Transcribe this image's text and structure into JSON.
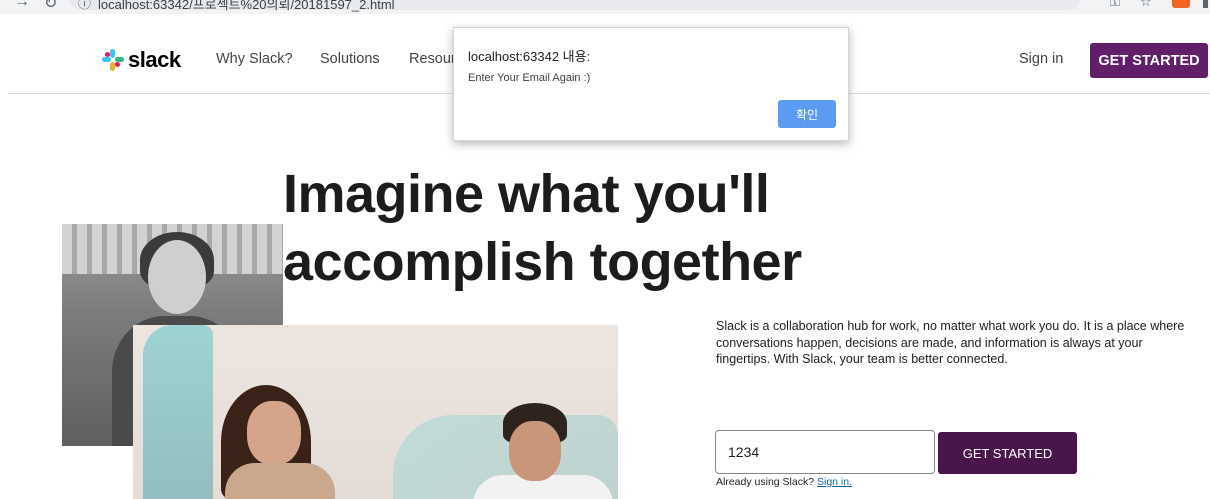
{
  "browser": {
    "url": "localhost:63342/프로젝트%20의뢰/20181597_2.html",
    "back_icon": "arrow-back-icon",
    "reload_icon": "reload-icon",
    "info_icon": "info-icon",
    "key_icon": "key-icon",
    "star_icon": "star-icon"
  },
  "header": {
    "logo_text": "slack",
    "nav": [
      "Why Slack?",
      "Solutions",
      "Resour"
    ],
    "sign_in": "Sign in",
    "get_started": "GET STARTED"
  },
  "hero": {
    "title_line1": "Imagine what you'll",
    "title_line2": "accomplish together",
    "description": "Slack is a collaboration hub for work, no matter what work you do. It is a place where conversations happen, decisions are made, and information is always at your fingertips. With Slack, your team is better connected."
  },
  "form": {
    "email_value": "1234",
    "get_started": "GET STARTED",
    "already_text": "Already using Slack?",
    "sign_in_link": "Sign in."
  },
  "dialog": {
    "title": "localhost:63342 내용:",
    "message": "Enter Your Email Again :)",
    "ok_label": "확인"
  },
  "colors": {
    "brand_purple": "#611f69",
    "form_button": "#4a154b",
    "dialog_button": "#5b9cf2",
    "link": "#1264a3"
  }
}
